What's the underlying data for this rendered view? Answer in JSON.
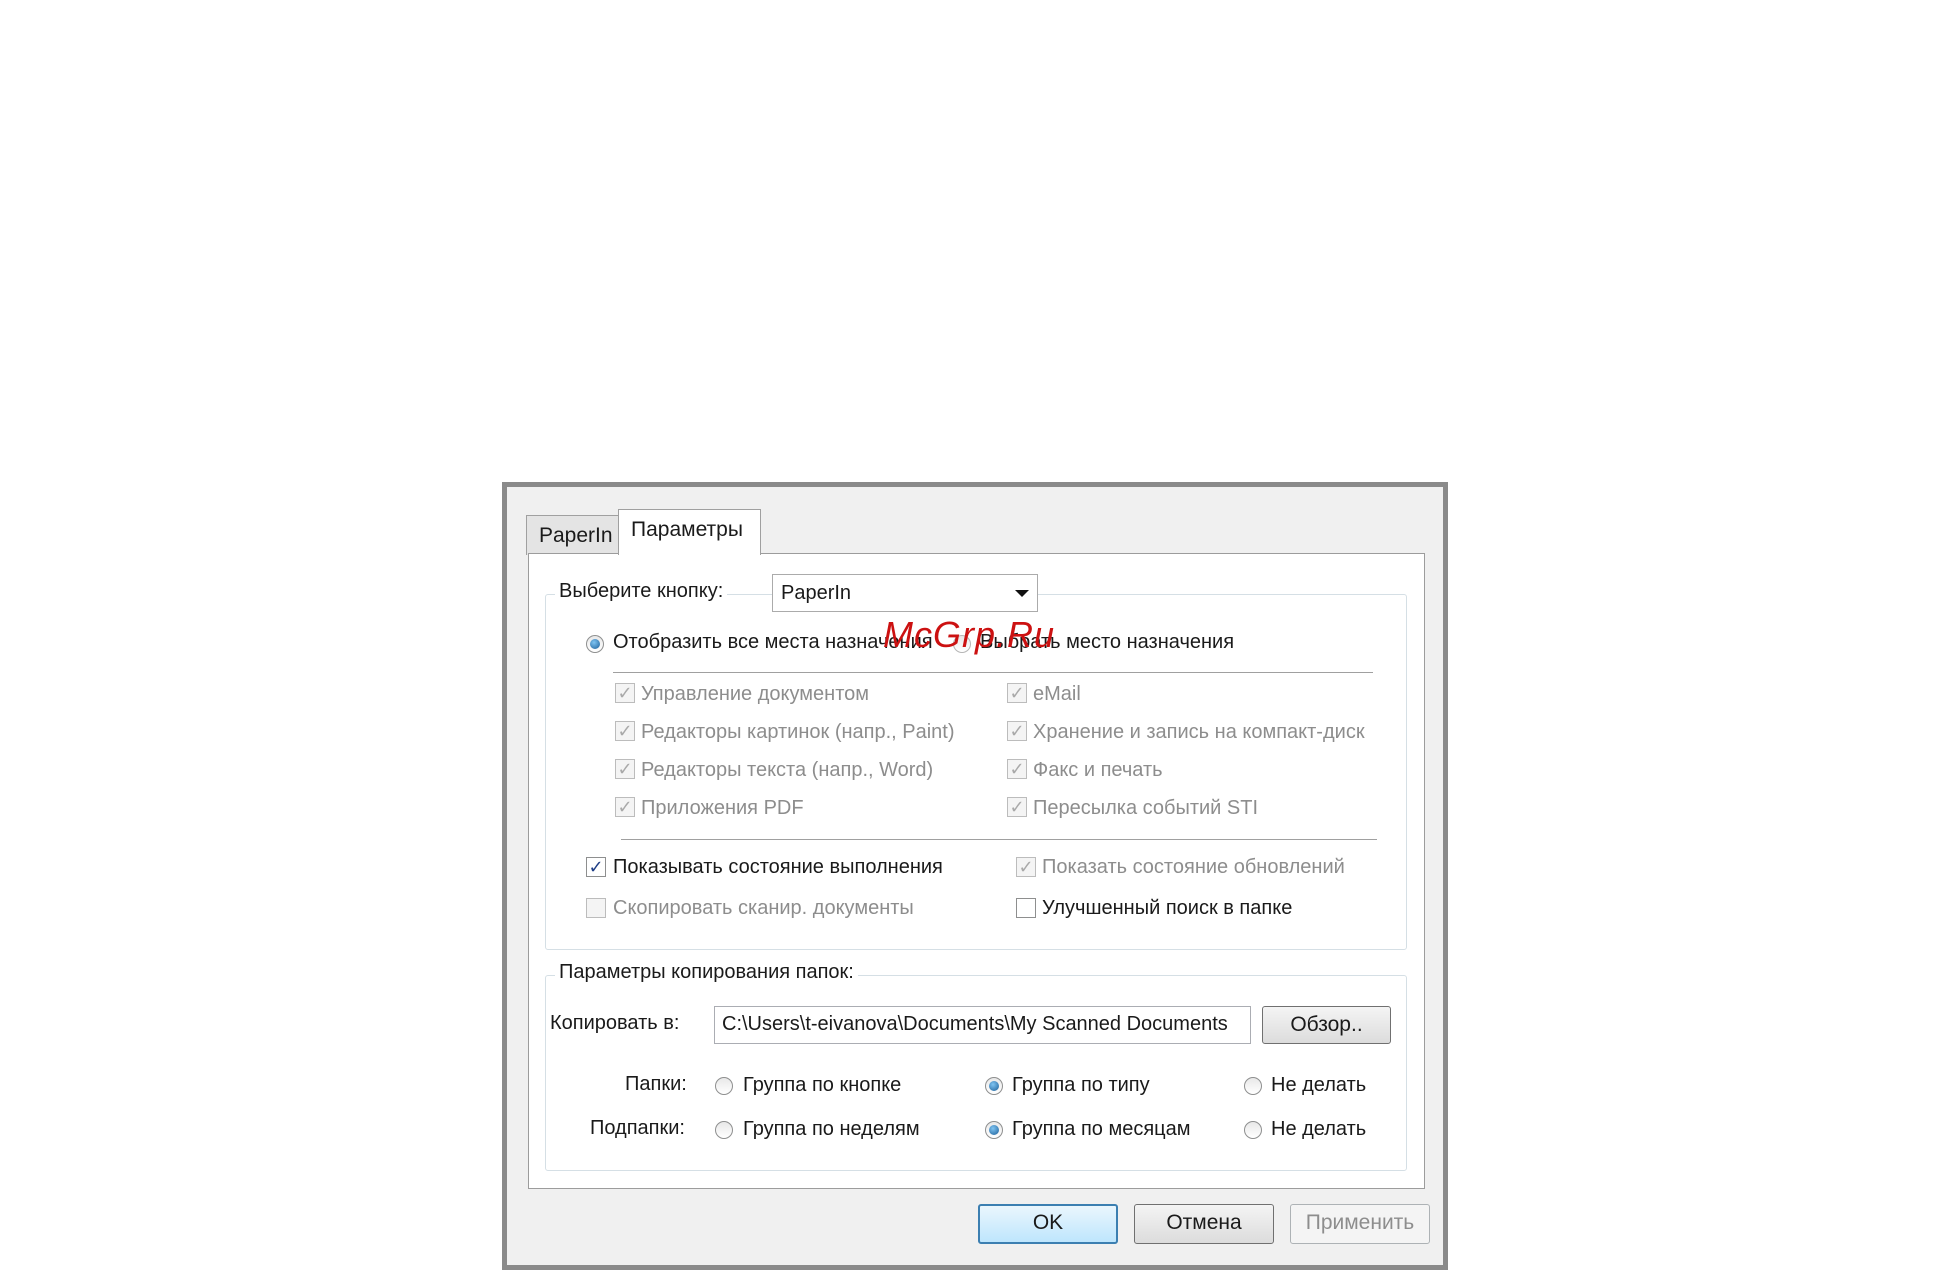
{
  "tabs": [
    {
      "label": "PaperIn",
      "active": false
    },
    {
      "label": "Параметры",
      "active": true
    }
  ],
  "button_group": {
    "label": "Выберите кнопку:",
    "selected": "PaperIn"
  },
  "destination_mode": {
    "show_all": {
      "label": "Отобразить все места назначения",
      "selected": true
    },
    "choose": {
      "label": "Выбрать место назначения",
      "selected": false
    }
  },
  "destinations": {
    "left": [
      {
        "label": "Управление документом",
        "checked": true,
        "enabled": false
      },
      {
        "label": "Редакторы картинок (напр., Paint)",
        "checked": true,
        "enabled": false
      },
      {
        "label": "Редакторы текста (напр., Word)",
        "checked": true,
        "enabled": false
      },
      {
        "label": "Приложения PDF",
        "checked": true,
        "enabled": false
      }
    ],
    "right": [
      {
        "label": "eMail",
        "checked": true,
        "enabled": false
      },
      {
        "label": "Хранение и запись на компакт-диск",
        "checked": true,
        "enabled": false
      },
      {
        "label": "Факс и печать",
        "checked": true,
        "enabled": false
      },
      {
        "label": "Пересылка событий STI",
        "checked": true,
        "enabled": false
      }
    ]
  },
  "options": {
    "show_progress": {
      "label": "Показывать состояние выполнения",
      "checked": true,
      "enabled": true
    },
    "show_update": {
      "label": "Показать состояние обновлений",
      "checked": true,
      "enabled": false
    },
    "copy_scanned": {
      "label": "Скопировать сканир. документы",
      "checked": false,
      "enabled": false
    },
    "improved_search": {
      "label": "Улучшенный поиск в папке",
      "checked": false,
      "enabled": true
    }
  },
  "folder_copy": {
    "legend": "Параметры копирования папок:",
    "copy_to_label": "Копировать в:",
    "copy_to_value": "C:\\Users\\t-eivanova\\Documents\\My Scanned Documents",
    "browse_label": "Обзор..",
    "folders_label": "Папки:",
    "folders_options": [
      {
        "label": "Группа по кнопке",
        "selected": false
      },
      {
        "label": "Группа по типу",
        "selected": true
      },
      {
        "label": "Не делать",
        "selected": false
      }
    ],
    "subfolders_label": "Подпапки:",
    "subfolders_options": [
      {
        "label": "Группа по неделям",
        "selected": false
      },
      {
        "label": "Группа по месяцам",
        "selected": true
      },
      {
        "label": "Не делать",
        "selected": false
      }
    ]
  },
  "buttons": {
    "ok": "OK",
    "cancel": "Отмена",
    "apply": "Применить"
  },
  "watermark": "McGrp.Ru",
  "colors": {
    "accent": "#3c7fb1",
    "watermark": "#cc1111",
    "disabled_text": "#8d8d8d"
  }
}
